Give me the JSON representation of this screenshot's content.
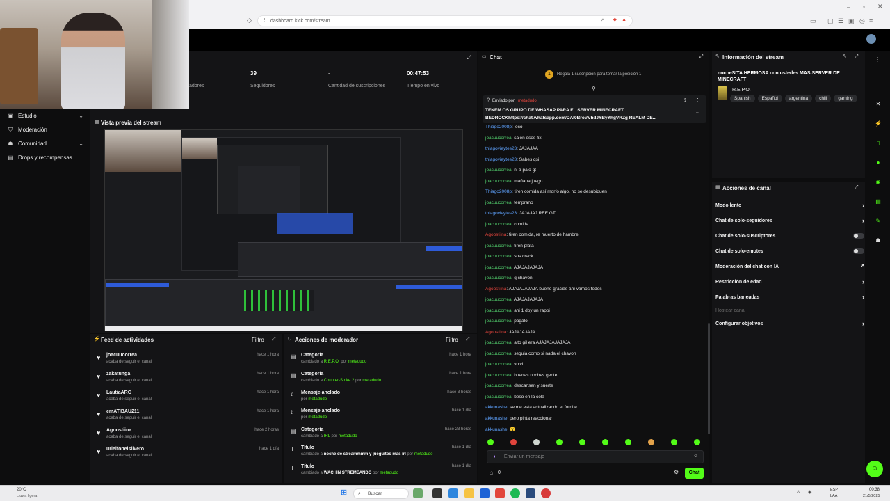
{
  "browser": {
    "url": "dashboard.kick.com/stream"
  },
  "nav": {
    "items": [
      {
        "label": "Estudio",
        "icon": "studio-icon",
        "has_chevron": true
      },
      {
        "label": "Moderación",
        "icon": "shield-icon",
        "has_chevron": false
      },
      {
        "label": "Comunidad",
        "icon": "people-icon",
        "has_chevron": true
      },
      {
        "label": "Drops y recompensas",
        "icon": "gift-icon",
        "has_chevron": false
      }
    ]
  },
  "stats": {
    "partial_label": "adores",
    "followers_value": "39",
    "followers_label": "Seguidores",
    "subs_value": "-",
    "subs_label": "Cantidad de suscripciones",
    "live_value": "00:47:53",
    "live_label": "Tiempo en vivo"
  },
  "preview": {
    "title": "Vista previa del stream"
  },
  "activity": {
    "title": "Feed de actividades",
    "filter": "Filtro",
    "items": [
      {
        "name": "joacuucorrea",
        "sub": "acaba de seguir el canal",
        "time": "hace 1 hora"
      },
      {
        "name": "zakatunga",
        "sub": "acaba de seguir el canal",
        "time": "hace 1 hora"
      },
      {
        "name": "LautiaARG",
        "sub": "acaba de seguir el canal",
        "time": "hace 1 hora"
      },
      {
        "name": "emATIBAU211",
        "sub": "acaba de seguir el canal",
        "time": "hace 1 hora"
      },
      {
        "name": "Agoostiina",
        "sub": "acaba de seguir el canal",
        "time": "hace 2 horas"
      },
      {
        "name": "urielfonelsilvero",
        "sub": "acaba de seguir el canal",
        "time": "hace 1 día"
      }
    ]
  },
  "modactions": {
    "title": "Acciones de moderador",
    "filter": "Filtro",
    "items": [
      {
        "icon": "category-icon",
        "title": "Categoría",
        "prefix": "cambiado a",
        "value": "R.E.P.O.",
        "by": "por",
        "user": "metadudo",
        "time": "hace 1 hora"
      },
      {
        "icon": "category-icon",
        "title": "Categoría",
        "prefix": "cambiado a",
        "value": "Counter-Strike 2",
        "by": "por",
        "user": "metadudo",
        "time": "hace 1 hora"
      },
      {
        "icon": "pin-icon",
        "title": "Mensaje anclado",
        "prefix": "por",
        "value": "",
        "by": "",
        "user": "metadudo",
        "time": "hace 3 horas"
      },
      {
        "icon": "pin-icon",
        "title": "Mensaje anclado",
        "prefix": "por",
        "value": "",
        "by": "",
        "user": "metadudo",
        "time": "hace 1 día"
      },
      {
        "icon": "category-icon",
        "title": "Categoría",
        "prefix": "cambiado a",
        "value": "IRL",
        "by": "por",
        "user": "metadudo",
        "time": "hace 23 horas"
      },
      {
        "icon": "title-icon",
        "title": "Título",
        "prefix": "cambiado a",
        "value": "noche de streammmm y jueguitos mas irl",
        "by": "por",
        "user": "metadudo",
        "time": "hace 1 día"
      },
      {
        "icon": "title-icon",
        "title": "Título",
        "prefix": "cambiado a",
        "value": "WACHIN STREMEANDO",
        "by": "por",
        "user": "metadudo",
        "time": "hace 1 día"
      }
    ]
  },
  "chat": {
    "title": "Chat",
    "gift_banner": "Regala 1 suscripción para tomar la posición 1",
    "pinned_by": "Enviado por",
    "pinned_user": "metadudo",
    "pinned_text1": "TENEM OS GRUPO DE WHASAP PARA EL SERVER MINECRAFT",
    "pinned_text2_prefix": "BEDROCK:",
    "pinned_link": "https://chat.whatsapp.com/DAl0BroVVhdJYByYhgVRZg REALM DE...",
    "messages": [
      {
        "user": "Thiago2008p",
        "color": "blue",
        "text": ": loco"
      },
      {
        "user": "joacuucorrea",
        "color": "green",
        "text": ": salen esos fix"
      },
      {
        "user": "thiagovieytes23",
        "color": "blue",
        "text": ": JAJAJAA"
      },
      {
        "user": "thiagovieytes23",
        "color": "blue",
        "text": ": Sabes qsi"
      },
      {
        "user": "joacuucorrea",
        "color": "green",
        "text": ": ni a palo gt"
      },
      {
        "user": "joacuucorrea",
        "color": "green",
        "text": ": mañana juego"
      },
      {
        "user": "Thiago2008p",
        "color": "blue",
        "text": ": tiren comida así morfo algo, no se desubiquen"
      },
      {
        "user": "joacuucorrea",
        "color": "green",
        "text": ": temprano"
      },
      {
        "user": "thiagovieytes23",
        "color": "blue",
        "text": ": JAJAJAJ REE GT"
      },
      {
        "user": "joacuucorrea",
        "color": "green",
        "text": ": comida"
      },
      {
        "user": "Agoostiina",
        "color": "red",
        "text": ": tiren comida, re muerto de hambre"
      },
      {
        "user": "joacuucorrea",
        "color": "green",
        "text": ": tiren plata"
      },
      {
        "user": "joacuucorrea",
        "color": "green",
        "text": ": sos crack"
      },
      {
        "user": "joacuucorrea",
        "color": "green",
        "text": ": AJAJAJAJAJA"
      },
      {
        "user": "joacuucorrea",
        "color": "green",
        "text": ": q chavon"
      },
      {
        "user": "Agoostiina",
        "color": "red",
        "text": ": AJAJAJAJAJA bueno gracias ahí vamos todos"
      },
      {
        "user": "joacuucorrea",
        "color": "green",
        "text": ": AJAJAJAJAJA"
      },
      {
        "user": "joacuucorrea",
        "color": "green",
        "text": ": ahi 1 doy un rappi"
      },
      {
        "user": "joacuucorrea",
        "color": "green",
        "text": ": pagalo"
      },
      {
        "user": "Agoostiina",
        "color": "red",
        "text": ": JAJAJAJAJA"
      },
      {
        "user": "joacuucorrea",
        "color": "green",
        "text": ": alto gil era AJAJAJAJAJAJA"
      },
      {
        "user": "joacuucorrea",
        "color": "green",
        "text": ": seguia como si nada el chavon"
      },
      {
        "user": "joacuucorrea",
        "color": "green",
        "text": ": volvi"
      },
      {
        "user": "joacuucorrea",
        "color": "green",
        "text": ": buenas noches gente"
      },
      {
        "user": "joacuucorrea",
        "color": "green",
        "text": ": descansen y suerte"
      },
      {
        "user": "joacuucorrea",
        "color": "green",
        "text": ": beso en la cola"
      },
      {
        "user": "akkunashe",
        "color": "blue",
        "text": ": se me esta actualizando el fornite"
      },
      {
        "user": "akkunashe",
        "color": "blue",
        "text": ": pero pinta reaccionar"
      },
      {
        "user": "akkunashe",
        "color": "blue",
        "text": ": 😮"
      }
    ],
    "input_placeholder": "Enviar un mensaje",
    "viewer_count": "0",
    "send_label": "Chat"
  },
  "info": {
    "title": "Información del stream",
    "stream_title": "nocheSITA HERMOSA con ustedes MAS SERVER DE MINECRAFT",
    "category": "R.E.P.O.",
    "tags": [
      "Spanish",
      "Español",
      "argentina",
      "chill",
      "gaming"
    ]
  },
  "actions": {
    "title": "Acciones de canal",
    "items": [
      {
        "label": "Modo lento",
        "control": "arrow"
      },
      {
        "label": "Chat de solo-seguidores",
        "control": "arrow"
      },
      {
        "label": "Chat de solo-suscriptores",
        "control": "toggle"
      },
      {
        "label": "Chat de solo-emotes",
        "control": "toggle"
      },
      {
        "label": "Moderación del chat con IA",
        "control": "external"
      },
      {
        "label": "Restricción de edad",
        "control": "arrow"
      },
      {
        "label": "Palabras baneadas",
        "control": "arrow"
      },
      {
        "label": "Hostear canal",
        "control": "disabled"
      },
      {
        "label": "Configurar objetivos",
        "control": "arrow"
      }
    ]
  },
  "taskbar": {
    "weather_temp": "20°C",
    "weather_desc": "Lluvia ligera",
    "search_label": "Buscar",
    "lang1": "ESP",
    "lang2": "LAA",
    "time": "00:38",
    "date": "21/5/2025"
  },
  "colors": {
    "accent": "#53fc18",
    "panel": "#141416",
    "background": "#0d0d0e"
  }
}
